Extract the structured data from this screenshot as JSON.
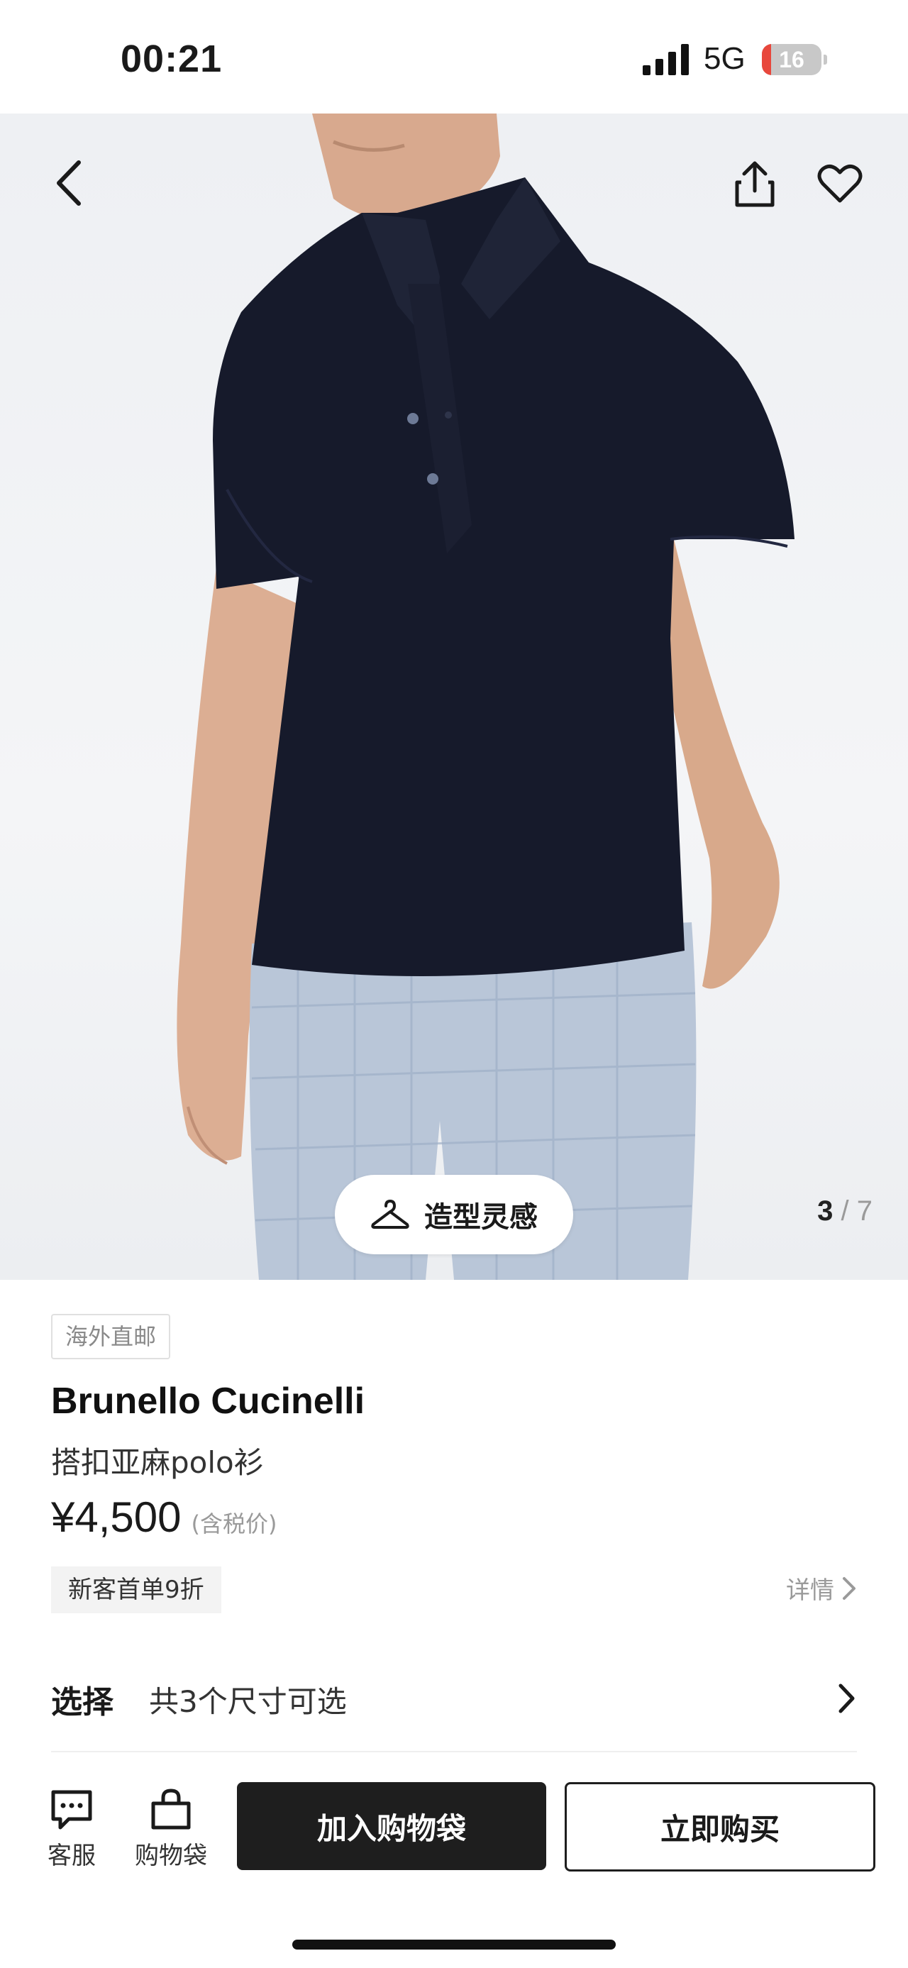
{
  "status_bar": {
    "time": "00:21",
    "network": "5G",
    "battery": "16",
    "battery_level": 0.16
  },
  "hero": {
    "style_button_label": "造型灵感",
    "pager_current": "3",
    "pager_separator": "/",
    "pager_total": "7"
  },
  "product": {
    "tag": "海外直邮",
    "brand": "Brunello Cucinelli",
    "name": "搭扣亚麻polo衫",
    "price": "¥4,500",
    "price_note": "(含税价)",
    "promo": "新客首单9折",
    "details_link": "详情"
  },
  "selection": {
    "label": "选择",
    "value": "共3个尺寸可选"
  },
  "bottom_bar": {
    "service_label": "客服",
    "bag_label": "购物袋",
    "add_to_bag": "加入购物袋",
    "buy_now": "立即购买"
  },
  "colors": {
    "battery_low": "#e8473c",
    "primary_button": "#1e1e1e",
    "shirt": "#161a2b",
    "pants": "#b9c6d8"
  },
  "icons": [
    "back-icon",
    "share-icon",
    "heart-icon",
    "hanger-icon",
    "chevron-right-icon",
    "chat-icon",
    "shopping-bag-icon"
  ]
}
